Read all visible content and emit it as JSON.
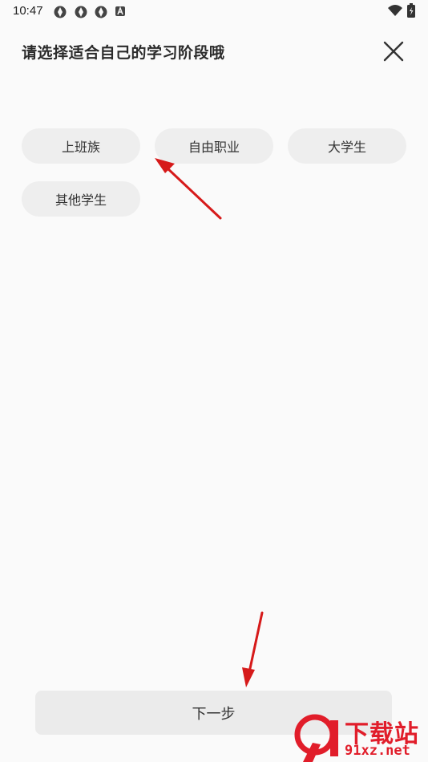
{
  "status_bar": {
    "time": "10:47",
    "notification_icons": [
      "aperture-icon",
      "aperture-icon",
      "aperture-icon",
      "a-badge-icon"
    ],
    "right_icons": [
      "wifi-icon",
      "battery-icon"
    ]
  },
  "header": {
    "title": "请选择适合自己的学习阶段哦",
    "close_icon": "close-icon"
  },
  "options": [
    {
      "label": "上班族"
    },
    {
      "label": "自由职业"
    },
    {
      "label": "大学生"
    },
    {
      "label": "其他学生"
    }
  ],
  "footer": {
    "next_label": "下一步"
  },
  "watermark": {
    "logo_text": "9",
    "title": "下载站",
    "domain": "91xz.net"
  },
  "colors": {
    "background": "#fafafa",
    "chip": "#eeeeee",
    "button": "#ebebeb",
    "annotation_arrow": "#d61a1a",
    "watermark": "#e11d2a"
  }
}
